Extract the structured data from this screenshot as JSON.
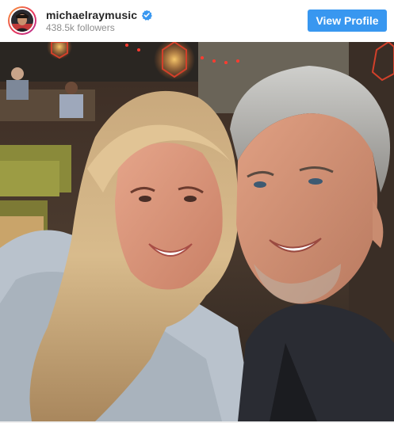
{
  "post": {
    "username": "michaelraymusic",
    "verified": true,
    "followers_label": "438.5k followers",
    "view_profile_label": "View Profile"
  },
  "icons": {
    "verified": "verified-badge-icon",
    "avatar": "profile-avatar"
  },
  "colors": {
    "button_bg": "#3897f0",
    "verified_badge": "#3897f0",
    "username_text": "#262626",
    "followers_text": "#8e8e8e"
  },
  "photo": {
    "subject": "selfie-two-people"
  }
}
